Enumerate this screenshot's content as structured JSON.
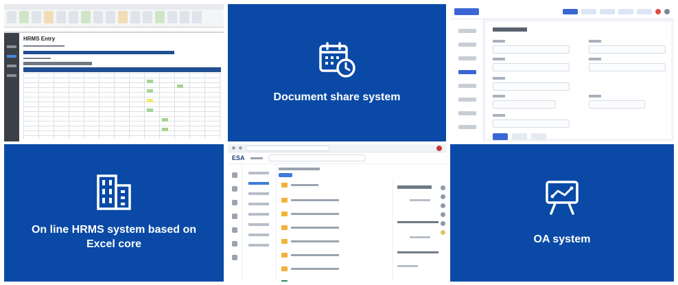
{
  "tiles": {
    "document_share": {
      "label": "Document share system",
      "icon": "calendar-clock-icon"
    },
    "hrms": {
      "label": "On line HRMS system based on Excel core",
      "icon": "office-building-icon"
    },
    "oa": {
      "label": "OA system",
      "icon": "presentation-board-icon"
    },
    "excel_screenshot": {
      "title": "HRMS Entry"
    },
    "share_screenshot": {
      "brand": "ESA"
    }
  },
  "colors": {
    "tile_blue": "#0a4aa6",
    "white": "#ffffff"
  }
}
